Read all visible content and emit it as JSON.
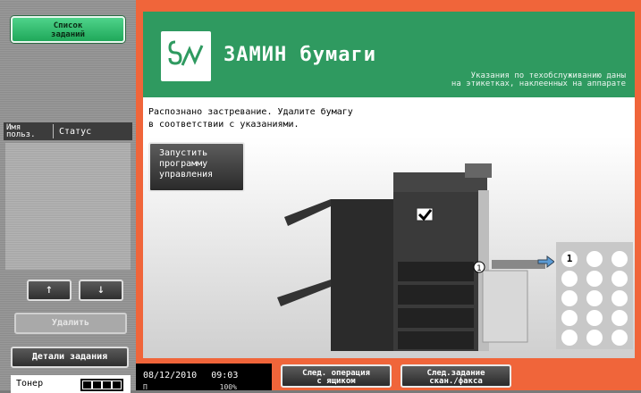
{
  "sidebar": {
    "job_list_button": "Список\nзаданий",
    "columns": {
      "user": "Имя\nпольз.",
      "status": "Статус"
    },
    "up_arrow": "↑",
    "down_arrow": "↓",
    "delete_button": "Удалить",
    "details_button": "Детали задания",
    "toner_label": "Тонер"
  },
  "header": {
    "title": "ЗАМИН бумаги",
    "subtitle": "Указания по техобслуживанию даны\nна этикетках, наклеенных на аппарате",
    "colors": {
      "accent": "#2f9a60",
      "frame": "#f0653a"
    }
  },
  "content": {
    "message": "Распознано застревание. Удалите бумагу\nв соответствии с указаниями.",
    "launch_button": "Запустить\nпрограмму\nуправления",
    "jam_marker_machine": "①",
    "grid": {
      "active_label": "1"
    }
  },
  "statusbar": {
    "date": "08/12/2010",
    "time": "09:03",
    "memory_label": "П",
    "memory_value": "100%",
    "next_tray_button": "След. операция\nс ящиком",
    "next_scan_button": "След.задание\nскан./факса"
  }
}
